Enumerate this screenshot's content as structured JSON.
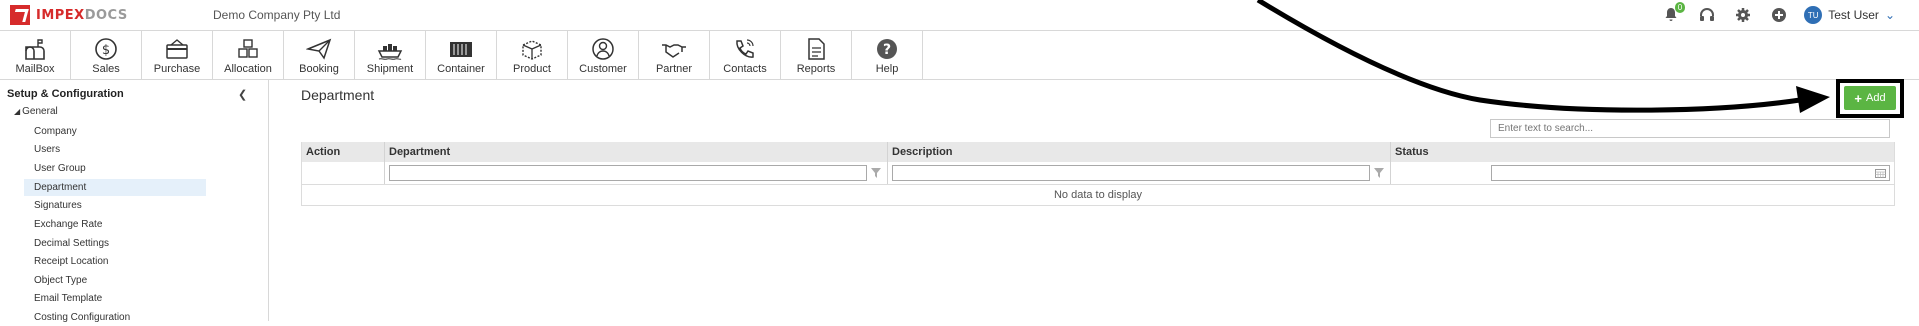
{
  "brand": {
    "part1": "IMPEX",
    "part2": "DOCS"
  },
  "company": "Demo Company Pty Ltd",
  "top_icons": {
    "notifications_badge": "0"
  },
  "user": {
    "initials": "TU",
    "name": "Test User"
  },
  "toolbar": [
    {
      "label": "MailBox",
      "icon": "mailbox-icon"
    },
    {
      "label": "Sales",
      "icon": "dollar-icon"
    },
    {
      "label": "Purchase",
      "icon": "card-icon"
    },
    {
      "label": "Allocation",
      "icon": "boxes-icon"
    },
    {
      "label": "Booking",
      "icon": "paper-plane-icon"
    },
    {
      "label": "Shipment",
      "icon": "ship-icon"
    },
    {
      "label": "Container",
      "icon": "container-icon"
    },
    {
      "label": "Product",
      "icon": "box-icon"
    },
    {
      "label": "Customer",
      "icon": "person-icon"
    },
    {
      "label": "Partner",
      "icon": "handshake-icon"
    },
    {
      "label": "Contacts",
      "icon": "phone-icon"
    },
    {
      "label": "Reports",
      "icon": "report-icon"
    },
    {
      "label": "Help",
      "icon": "help-icon"
    }
  ],
  "sidebar": {
    "title": "Setup & Configuration",
    "group": "General",
    "items": [
      "Company",
      "Users",
      "User Group",
      "Department",
      "Signatures",
      "Exchange Rate",
      "Decimal Settings",
      "Receipt Location",
      "Object Type",
      "Email Template",
      "Costing Configuration"
    ],
    "active_index": 3
  },
  "main": {
    "title": "Department",
    "add_label": "Add",
    "search_placeholder": "Enter text to search...",
    "columns": [
      "Action",
      "Department",
      "Description",
      "Status"
    ],
    "empty_text": "No data to display"
  },
  "colors": {
    "accent_green": "#5bb543",
    "brand_red": "#d62b2b",
    "active_row": "#e5f0fa"
  }
}
